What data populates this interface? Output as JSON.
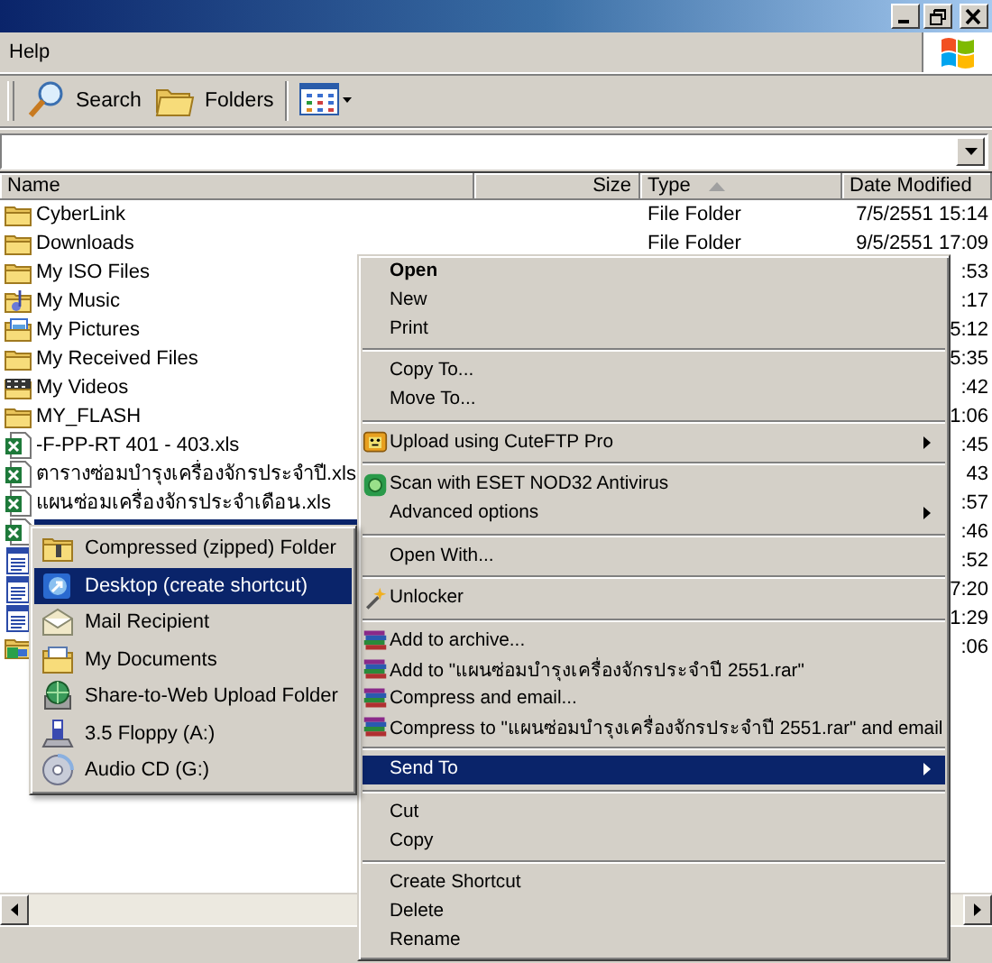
{
  "menu_bar": {
    "items": [
      "Help"
    ]
  },
  "toolbar": {
    "buttons": [
      {
        "label": "Search"
      },
      {
        "label": "Folders"
      }
    ]
  },
  "file_list": {
    "columns": [
      {
        "label": "Name",
        "sorted": false
      },
      {
        "label": "Size",
        "sorted": false
      },
      {
        "label": "Type",
        "sorted": true
      },
      {
        "label": "Date Modified",
        "sorted": false
      }
    ],
    "rows": [
      {
        "kind": "folder",
        "name": "CyberLink",
        "type": "File Folder",
        "date": "7/5/2551 15:14",
        "selected": false
      },
      {
        "kind": "folder",
        "name": "Downloads",
        "type": "File Folder",
        "date": "9/5/2551 17:09",
        "selected": false
      },
      {
        "kind": "folder",
        "name": "My ISO Files",
        "date": ":53",
        "selected": false
      },
      {
        "kind": "music",
        "name": "My Music",
        "date": ":17",
        "selected": false
      },
      {
        "kind": "pictures",
        "name": "My Pictures",
        "date": "5:12",
        "selected": false
      },
      {
        "kind": "folder",
        "name": "My Received Files",
        "date": "5:35",
        "selected": false
      },
      {
        "kind": "videos",
        "name": "My Videos",
        "date": ":42",
        "selected": false
      },
      {
        "kind": "folder",
        "name": "MY_FLASH",
        "date": "1:06",
        "selected": false
      },
      {
        "kind": "excel",
        "name": "-F-PP-RT 401 - 403.xls",
        "date": ":45",
        "selected": false
      },
      {
        "kind": "excel",
        "name": "ตารางซ่อมบำรุงเครื่องจักรประจำปี.xls",
        "date": "43",
        "selected": false
      },
      {
        "kind": "excel",
        "name": "แผนซ่อมเครื่องจักรประจำเดือน.xls",
        "date": ":57",
        "selected": false
      },
      {
        "kind": "excel",
        "date": ":46",
        "selected": true
      },
      {
        "kind": "word",
        "date": ":52",
        "selected": false
      },
      {
        "kind": "word",
        "date": "7:20",
        "selected": false
      },
      {
        "kind": "word",
        "date": "1:29",
        "selected": false
      },
      {
        "kind": "network",
        "date": ":06",
        "selected": false
      }
    ]
  },
  "context_menu": {
    "items": [
      {
        "kind": "plain",
        "label": "Open",
        "default": true,
        "selected": false,
        "submenu": false
      },
      {
        "kind": "plain",
        "label": "New",
        "default": false,
        "selected": false,
        "submenu": false
      },
      {
        "kind": "plain",
        "label": "Print",
        "default": false,
        "selected": false,
        "submenu": false
      },
      {
        "kind": "separator"
      },
      {
        "kind": "plain",
        "label": "Copy To...",
        "default": false,
        "selected": false,
        "submenu": false
      },
      {
        "kind": "plain",
        "label": "Move To...",
        "default": false,
        "selected": false,
        "submenu": false
      },
      {
        "kind": "separator"
      },
      {
        "kind": "ftp",
        "label": "Upload using CuteFTP Pro",
        "default": false,
        "selected": false,
        "submenu": true
      },
      {
        "kind": "separator"
      },
      {
        "kind": "scan",
        "label": "Scan with ESET NOD32 Antivirus",
        "default": false,
        "selected": false,
        "submenu": false
      },
      {
        "kind": "plain",
        "label": "Advanced options",
        "default": false,
        "selected": false,
        "submenu": true
      },
      {
        "kind": "separator"
      },
      {
        "kind": "plain",
        "label": "Open With...",
        "default": false,
        "selected": false,
        "submenu": false
      },
      {
        "kind": "separator"
      },
      {
        "kind": "unlock",
        "label": "Unlocker",
        "default": false,
        "selected": false,
        "submenu": false
      },
      {
        "kind": "separator"
      },
      {
        "kind": "archive",
        "label": "Add to archive...",
        "default": false,
        "selected": false,
        "submenu": false
      },
      {
        "kind": "archive",
        "label": "Add to \"แผนซ่อมบำรุงเครื่องจักรประจำปี 2551.rar\"",
        "default": false,
        "selected": false,
        "submenu": false
      },
      {
        "kind": "archive",
        "label": "Compress and email...",
        "default": false,
        "selected": false,
        "submenu": false
      },
      {
        "kind": "archive",
        "label": "Compress to \"แผนซ่อมบำรุงเครื่องจักรประจำปี 2551.rar\" and email",
        "default": false,
        "selected": false,
        "submenu": false
      },
      {
        "kind": "separator"
      },
      {
        "kind": "plain",
        "label": "Send To",
        "default": false,
        "selected": true,
        "submenu": true
      },
      {
        "kind": "separator"
      },
      {
        "kind": "plain",
        "label": "Cut",
        "default": false,
        "selected": false,
        "submenu": false
      },
      {
        "kind": "plain",
        "label": "Copy",
        "default": false,
        "selected": false,
        "submenu": false
      },
      {
        "kind": "separator"
      },
      {
        "kind": "plain",
        "label": "Create Shortcut",
        "default": false,
        "selected": false,
        "submenu": false
      },
      {
        "kind": "plain",
        "label": "Delete",
        "default": false,
        "selected": false,
        "submenu": false
      },
      {
        "kind": "plain",
        "label": "Rename",
        "default": false,
        "selected": false,
        "submenu": false
      }
    ]
  },
  "send_to_menu": {
    "items": [
      {
        "kind": "zip",
        "label": "Compressed (zipped) Folder",
        "selected": false
      },
      {
        "kind": "desktop",
        "label": "Desktop (create shortcut)",
        "selected": true
      },
      {
        "kind": "mail",
        "label": "Mail Recipient",
        "selected": false
      },
      {
        "kind": "documents",
        "label": "My Documents",
        "selected": false
      },
      {
        "kind": "web",
        "label": "Share-to-Web Upload Folder",
        "selected": false
      },
      {
        "kind": "floppy",
        "label": "3.5 Floppy (A:)",
        "selected": false
      },
      {
        "kind": "cd",
        "label": "Audio CD (G:)",
        "selected": false
      }
    ]
  }
}
